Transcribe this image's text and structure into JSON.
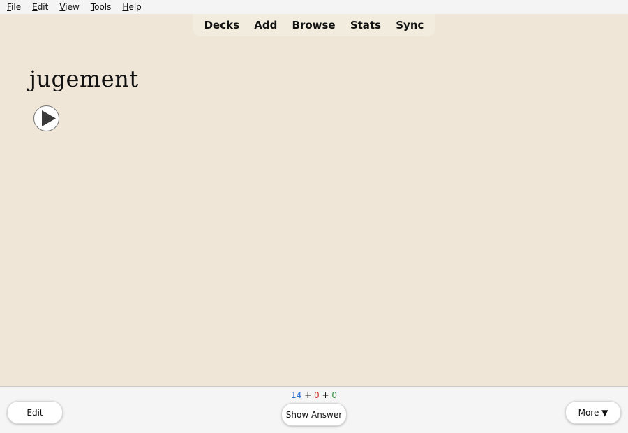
{
  "menu": [
    {
      "label": "File",
      "underline": "F",
      "rest": "ile"
    },
    {
      "label": "Edit",
      "underline": "E",
      "rest": "dit"
    },
    {
      "label": "View",
      "underline": "V",
      "rest": "iew"
    },
    {
      "label": "Tools",
      "underline": "T",
      "rest": "ools"
    },
    {
      "label": "Help",
      "underline": "H",
      "rest": "elp"
    }
  ],
  "toolbar": {
    "decks": "Decks",
    "add": "Add",
    "browse": "Browse",
    "stats": "Stats",
    "sync": "Sync"
  },
  "card": {
    "front_text": "jugement",
    "audio_icon": "play-icon"
  },
  "bottom": {
    "edit_label": "Edit",
    "show_answer_label": "Show Answer",
    "more_label": "More ▼",
    "counts": {
      "new": "14",
      "learn": "0",
      "review": "0",
      "sep1": " + ",
      "sep2": " + "
    }
  },
  "colors": {
    "background": "#efe6d7",
    "new_count": "#2a6fcf",
    "learn_count": "#cc2b2b",
    "review_count": "#2e8b3a"
  }
}
